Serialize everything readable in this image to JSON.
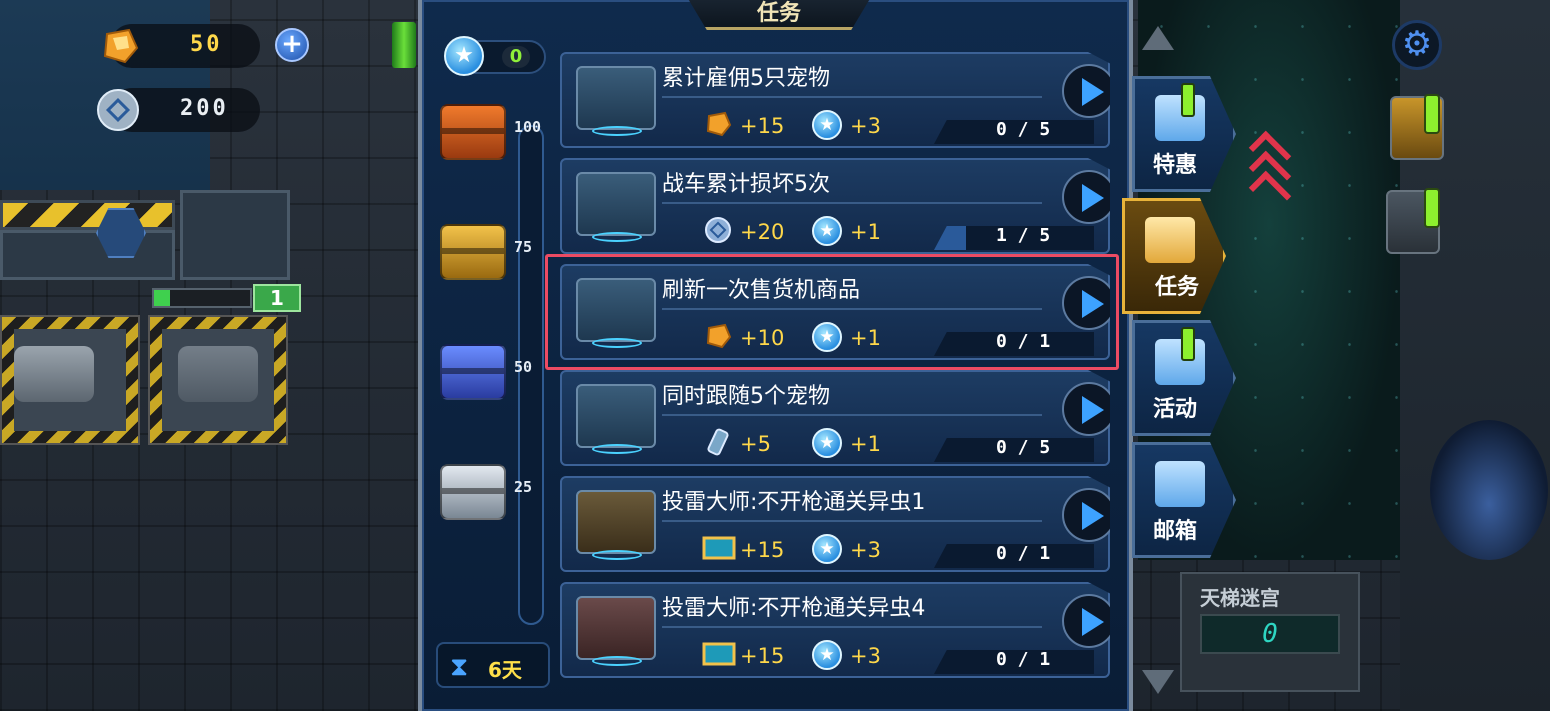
{
  "resources": {
    "crystal": {
      "value": "50",
      "icon": "orange-crystal-icon"
    },
    "coin": {
      "value": "200",
      "icon": "silver-coin-icon"
    }
  },
  "garage": {
    "level": "1"
  },
  "panel": {
    "title": "任务",
    "star_points": "0",
    "progress_milestones": [
      "100",
      "75",
      "50",
      "25"
    ],
    "timer": "6天",
    "tasks": [
      {
        "name": "累计雇佣5只宠物",
        "reward_icon": "crystal-icon",
        "reward": "+15",
        "stars": "+3",
        "progress": "0 / 5"
      },
      {
        "name": "战车累计损坏5次",
        "reward_icon": "coin-icon",
        "reward": "+20",
        "stars": "+1",
        "progress": "1 / 5"
      },
      {
        "name": "刷新一次售货机商品",
        "reward_icon": "crystal-icon",
        "reward": "+10",
        "stars": "+1",
        "progress": "0 / 1"
      },
      {
        "name": "同时跟随5个宠物",
        "reward_icon": "battery-icon",
        "reward": "+5",
        "stars": "+1",
        "progress": "0 / 5"
      },
      {
        "name": "投雷大师:不开枪通关异虫1",
        "reward_icon": "blueprint-icon",
        "reward": "+15",
        "stars": "+3",
        "progress": "0 / 1"
      },
      {
        "name": "投雷大师:不开枪通关异虫4",
        "reward_icon": "blueprint-icon",
        "reward": "+15",
        "stars": "+3",
        "progress": "0 / 1"
      }
    ]
  },
  "side_tabs": [
    {
      "label": "特惠",
      "active": false,
      "alert": true
    },
    {
      "label": "任务",
      "active": true,
      "alert": false
    },
    {
      "label": "活动",
      "active": false,
      "alert": true
    },
    {
      "label": "邮箱",
      "active": false,
      "alert": false
    }
  ],
  "ladder": {
    "title": "天梯迷宫",
    "value": "0"
  },
  "colors": {
    "accent_yellow": "#ffd84a",
    "highlight": "#ec4b63",
    "star_blue": "#2a8fe0"
  }
}
